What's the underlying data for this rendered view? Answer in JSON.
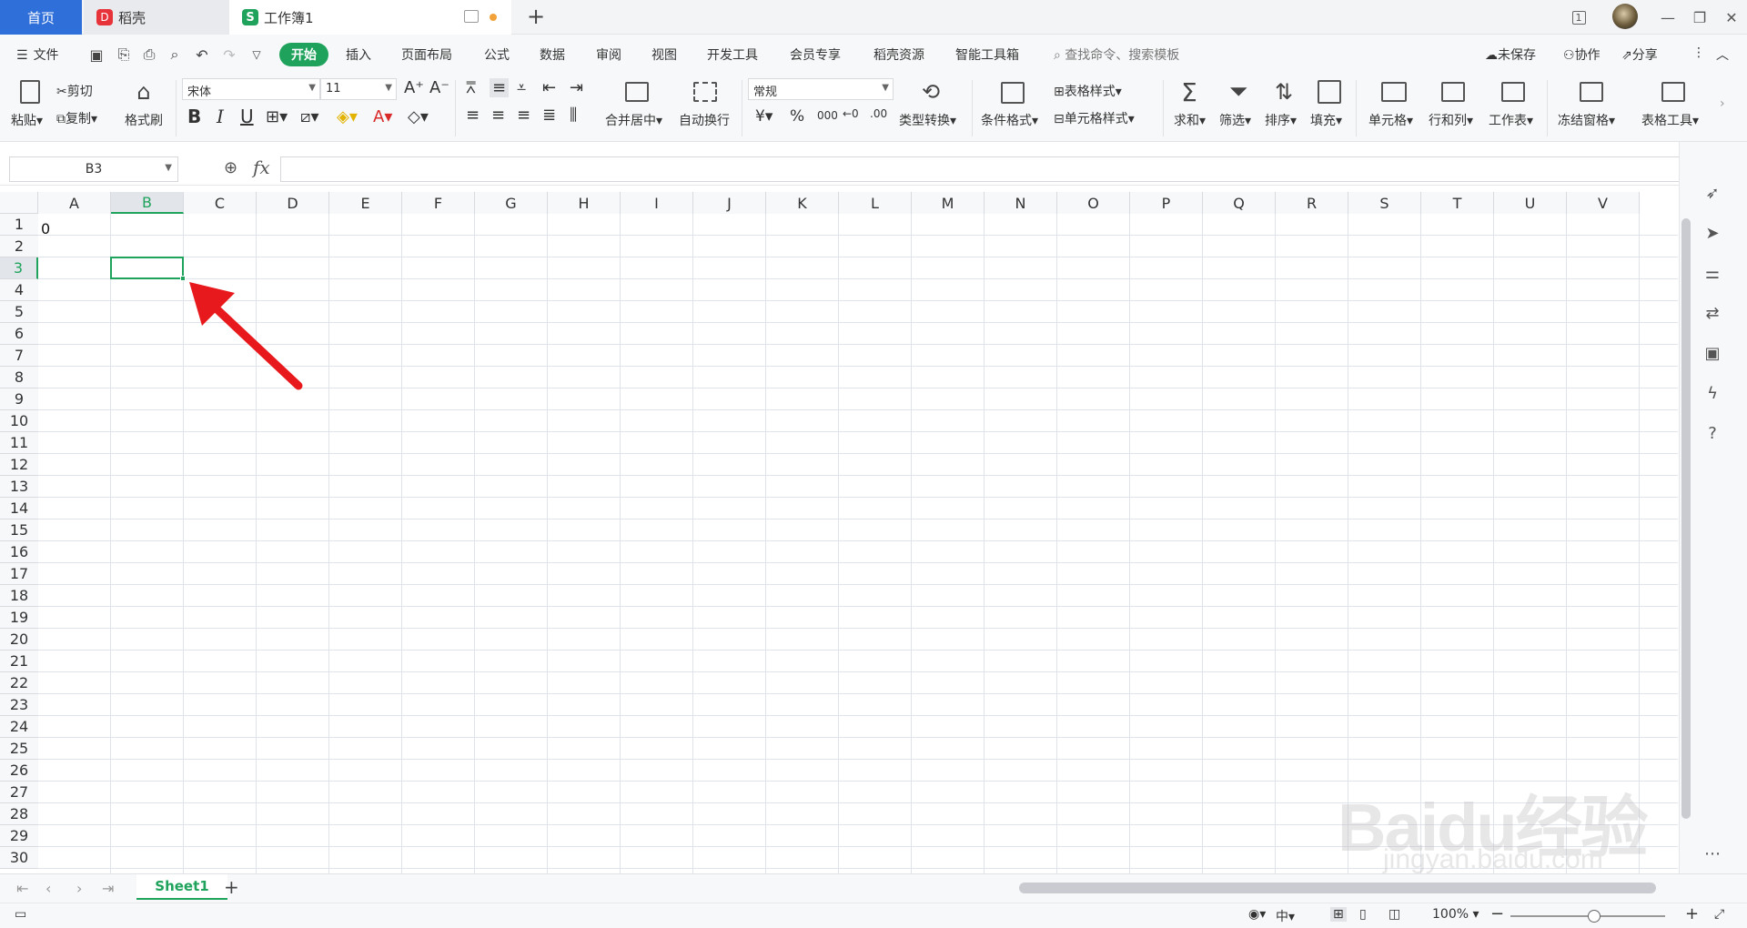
{
  "titlebar": {
    "tabs": [
      {
        "label": "首页"
      },
      {
        "label": "稻壳",
        "logo": "D"
      },
      {
        "label": "工作簿1",
        "logo": "S"
      }
    ],
    "new_tab": "+",
    "account_badge": "1"
  },
  "menu": {
    "file": "文件",
    "items": [
      "开始",
      "插入",
      "页面布局",
      "公式",
      "数据",
      "审阅",
      "视图",
      "开发工具",
      "会员专享",
      "稻壳资源",
      "智能工具箱"
    ],
    "search_placeholder": "查找命令、搜索模板",
    "unsaved": "未保存",
    "collab": "协作",
    "share": "分享"
  },
  "ribbon": {
    "paste": "粘贴",
    "cut": "剪切",
    "copy": "复制",
    "format_painter": "格式刷",
    "font_family": "宋体",
    "font_size": "11",
    "bold": "B",
    "italic": "I",
    "underline": "U",
    "merge_center": "合并居中",
    "auto_wrap": "自动换行",
    "number_format": "常规",
    "currency": "¥",
    "percent": "%",
    "thousands": "000",
    "type_convert": "类型转换",
    "cond_format": "条件格式",
    "table_style": "表格样式",
    "cell_style": "单元格样式",
    "sum": "求和",
    "filter": "筛选",
    "sort": "排序",
    "fill": "填充",
    "cell": "单元格",
    "row_col": "行和列",
    "worksheet": "工作表",
    "freeze": "冻结窗格",
    "table_tools": "表格工具"
  },
  "formula_bar": {
    "name_box": "B3",
    "fx": "fx",
    "value": ""
  },
  "grid": {
    "columns": [
      "A",
      "B",
      "C",
      "D",
      "E",
      "F",
      "G",
      "H",
      "I",
      "J",
      "K",
      "L",
      "M",
      "N",
      "O",
      "P",
      "Q",
      "R",
      "S",
      "T",
      "U",
      "V"
    ],
    "rows": [
      "1",
      "2",
      "3",
      "4",
      "5",
      "6",
      "7",
      "8",
      "9",
      "10",
      "11",
      "12",
      "13",
      "14",
      "15",
      "16",
      "17",
      "18",
      "19",
      "20",
      "21",
      "22",
      "23",
      "24",
      "25",
      "26",
      "27",
      "28",
      "29",
      "30"
    ],
    "cells": {
      "A1": "0"
    },
    "active_cell": "B3"
  },
  "sheets": {
    "tabs": [
      "Sheet1"
    ],
    "add": "+"
  },
  "status": {
    "zoom": "100%"
  },
  "watermark": {
    "brand": "Baidu经验",
    "url": "jingyan.baidu.com"
  },
  "colors": {
    "accent": "#1fa35c",
    "home_tab": "#2f6fd9",
    "arrow": "#e8191c"
  }
}
